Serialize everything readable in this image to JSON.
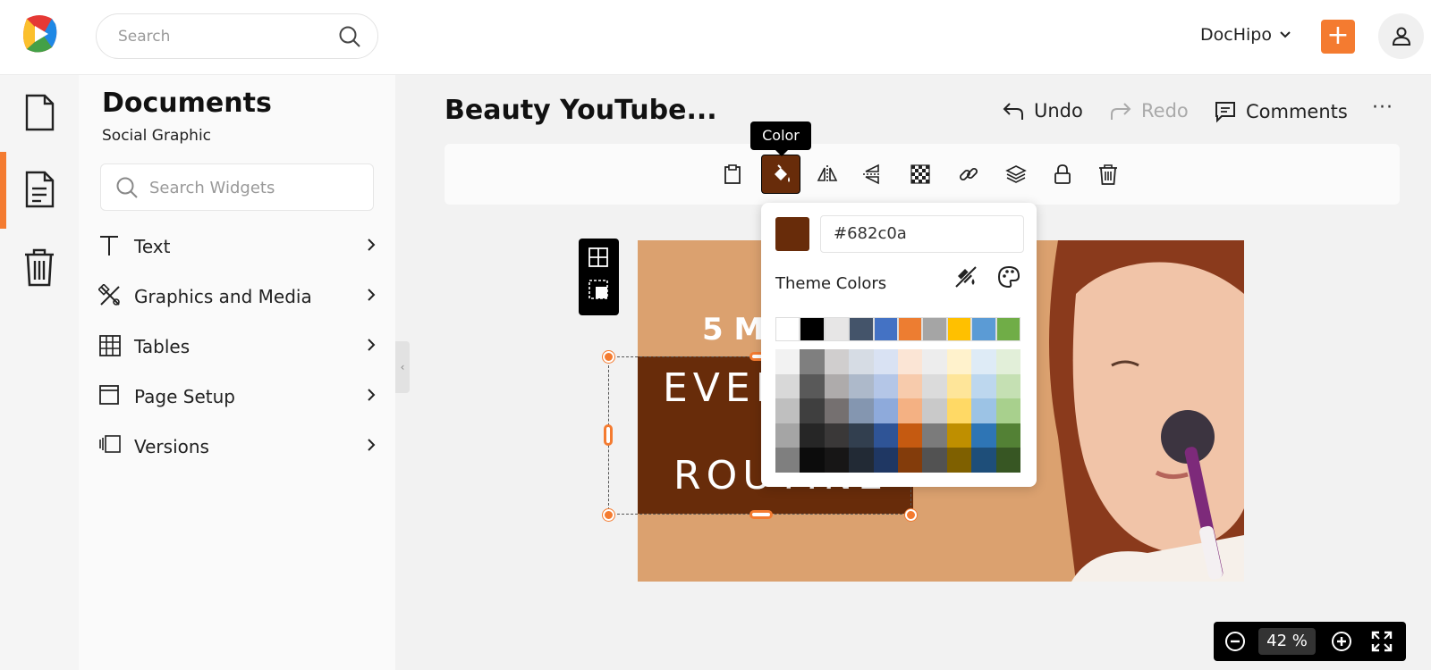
{
  "header": {
    "search_placeholder": "Search",
    "account_name": "DocHipo",
    "plus_label": "+"
  },
  "sidebar": {
    "title": "Documents",
    "subtitle": "Social Graphic",
    "widget_search_placeholder": "Search Widgets",
    "items": [
      {
        "label": "Text"
      },
      {
        "label": "Graphics and Media"
      },
      {
        "label": "Tables"
      },
      {
        "label": "Page Setup"
      },
      {
        "label": "Versions"
      }
    ]
  },
  "editor": {
    "doc_title": "Beauty YouTube...",
    "undo_label": "Undo",
    "redo_label": "Redo",
    "comments_label": "Comments",
    "more_label": "···",
    "tooltip": "Color"
  },
  "canvas": {
    "small_heading": "5 Mi",
    "line1": "EVER",
    "line2": "ROUTINE",
    "brand_color": "#682c0a",
    "background_color": "#dba16f"
  },
  "color_popup": {
    "hex_value": "#682c0a",
    "theme_label": "Theme Colors",
    "top_row": [
      "#ffffff",
      "#000000",
      "#e7e6e6",
      "#44546a",
      "#4472c4",
      "#ed7d31",
      "#a5a5a5",
      "#ffc000",
      "#5b9bd5",
      "#70ad47"
    ],
    "shades": [
      [
        "#f2f2f2",
        "#7f7f7f",
        "#d0cece",
        "#d6dce4",
        "#d9e2f3",
        "#fbe5d5",
        "#ededed",
        "#fff2cc",
        "#deebf6",
        "#e2efd9"
      ],
      [
        "#d8d8d8",
        "#595959",
        "#aeabab",
        "#adb9ca",
        "#b4c6e7",
        "#f7cbac",
        "#dbdbdb",
        "#fee599",
        "#bdd7ee",
        "#c5e0b3"
      ],
      [
        "#bfbfbf",
        "#3f3f3f",
        "#757070",
        "#8496b0",
        "#8eaadb",
        "#f4b183",
        "#c9c9c9",
        "#ffd965",
        "#9cc3e5",
        "#a8d08d"
      ],
      [
        "#a5a5a5",
        "#262626",
        "#3a3838",
        "#323f4f",
        "#2f5496",
        "#c55a11",
        "#7b7b7b",
        "#bf8f00",
        "#2e75b5",
        "#538135"
      ],
      [
        "#7f7f7f",
        "#0c0c0c",
        "#171616",
        "#222a35",
        "#1f3763",
        "#833c0b",
        "#525252",
        "#7f6000",
        "#1e4e79",
        "#375623"
      ]
    ]
  },
  "zoom": {
    "value": "42",
    "unit": "%"
  },
  "colors": {
    "accent": "#f47b30"
  }
}
